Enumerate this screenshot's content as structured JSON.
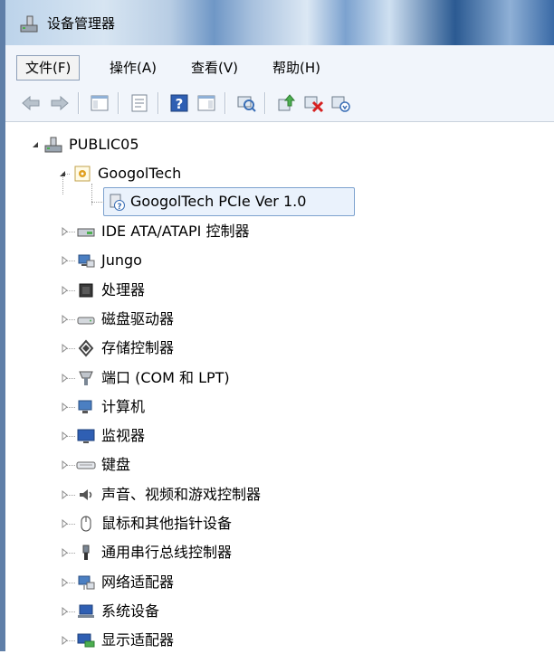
{
  "window": {
    "title": "设备管理器"
  },
  "menu": [
    "文件(F)",
    "操作(A)",
    "查看(V)",
    "帮助(H)"
  ],
  "toolbar": {
    "buttons": [
      "back-icon",
      "forward-icon",
      "show-hide-console-tree-icon",
      "properties-icon",
      "help-icon",
      "action-pane-icon",
      "scan-hardware-icon",
      "update-driver-icon",
      "uninstall-icon",
      "disable-icon"
    ]
  },
  "tree": {
    "root": "PUBLIC05",
    "expanded_category": "GoogolTech",
    "expanded_child": "GoogolTech PCIe Ver 1.0",
    "categories": [
      "IDE ATA/ATAPI 控制器",
      "Jungo",
      "处理器",
      "磁盘驱动器",
      "存储控制器",
      "端口 (COM 和 LPT)",
      "计算机",
      "监视器",
      "键盘",
      "声音、视频和游戏控制器",
      "鼠标和其他指针设备",
      "通用串行总线控制器",
      "网络适配器",
      "系统设备",
      "显示适配器"
    ]
  },
  "colors": {
    "selection_border": "#7da2ce",
    "selection_fill": "#eaf2fc",
    "menu_bg": "#f1f5fb"
  }
}
